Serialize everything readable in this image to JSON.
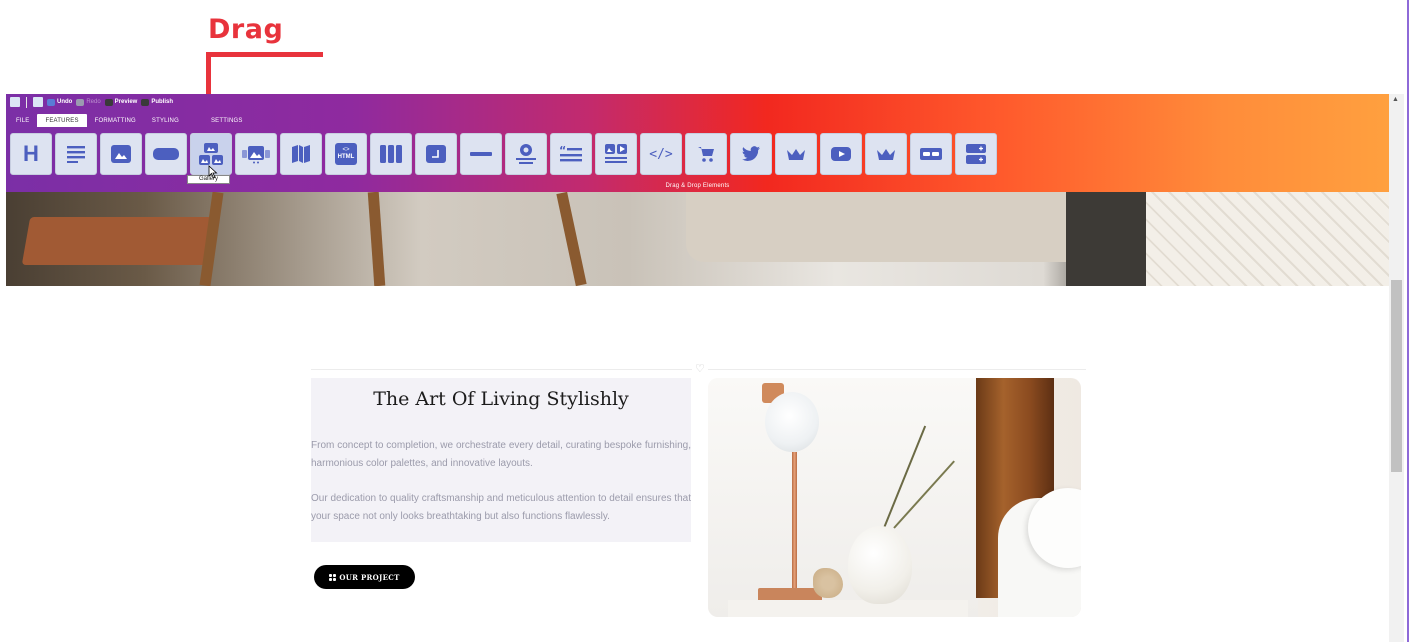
{
  "annotation": {
    "drag_label": "Drag",
    "color": "#e8333c"
  },
  "toolbar": {
    "quick_actions": [
      {
        "name": "undo",
        "label": "Undo"
      },
      {
        "name": "redo",
        "label": "Redo"
      },
      {
        "name": "preview",
        "label": "Preview"
      },
      {
        "name": "publish",
        "label": "Publish"
      }
    ],
    "tabs": [
      {
        "label": "FILE"
      },
      {
        "label": "FEATURES",
        "active": true
      },
      {
        "label": "FORMATTING"
      },
      {
        "label": "STYLING"
      },
      {
        "label": "SETTINGS"
      }
    ],
    "elements": [
      {
        "name": "heading",
        "icon": "heading-icon",
        "glyph": "H"
      },
      {
        "name": "text",
        "icon": "text-lines-icon"
      },
      {
        "name": "image",
        "icon": "image-icon"
      },
      {
        "name": "button",
        "icon": "button-icon"
      },
      {
        "name": "gallery",
        "icon": "gallery-icon",
        "hovered": true
      },
      {
        "name": "slider",
        "icon": "image-slider-icon"
      },
      {
        "name": "map",
        "icon": "map-icon"
      },
      {
        "name": "html",
        "icon": "html-code-icon",
        "glyph": "HTML"
      },
      {
        "name": "columns",
        "icon": "columns-icon"
      },
      {
        "name": "box",
        "icon": "box-icon"
      },
      {
        "name": "divider",
        "icon": "divider-icon"
      },
      {
        "name": "icon-box",
        "icon": "icon-box-icon"
      },
      {
        "name": "quote",
        "icon": "quote-icon"
      },
      {
        "name": "media-text",
        "icon": "media-text-icon"
      },
      {
        "name": "code",
        "icon": "code-icon",
        "glyph": "</>"
      },
      {
        "name": "cart",
        "icon": "cart-icon"
      },
      {
        "name": "twitter",
        "icon": "twitter-icon"
      },
      {
        "name": "crown",
        "icon": "crown-icon"
      },
      {
        "name": "youtube",
        "icon": "youtube-icon"
      },
      {
        "name": "crown-2",
        "icon": "crown-icon"
      },
      {
        "name": "spacer",
        "icon": "spacer-icon"
      },
      {
        "name": "accordion",
        "icon": "accordion-icon"
      }
    ],
    "tooltip": "Gallery",
    "footer_label": "Drag & Drop Elements"
  },
  "content": {
    "heading": "The Art Of Living Stylishly",
    "paragraph_1": "From concept to completion, we orchestrate every detail, curating bespoke furnishing, harmonious color palettes, and innovative layouts.",
    "paragraph_2": "Our dedication to quality craftsmanship and meticulous attention to detail ensures that your space not only looks breathtaking but also functions flawlessly.",
    "cta_label": "OUR PROJECT"
  },
  "colors": {
    "gradient_start": "#7b2fa6",
    "gradient_mid": "#f2281f",
    "gradient_end": "#ffa03f",
    "element_icon": "#4c5fbf",
    "cta_background": "#000000"
  }
}
